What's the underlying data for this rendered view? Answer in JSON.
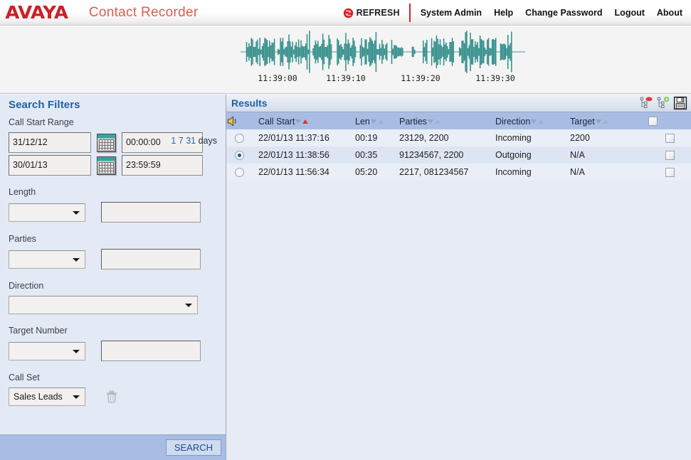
{
  "app": {
    "brand": "AVAYA",
    "title": "Contact Recorder"
  },
  "topnav": {
    "refresh_label": "REFRESH",
    "refresh_icon": "refresh-icon",
    "items": [
      {
        "label": "System Admin"
      },
      {
        "label": "Help"
      },
      {
        "label": "Change Password"
      },
      {
        "label": "Logout"
      },
      {
        "label": "About"
      }
    ]
  },
  "waveform": {
    "color": "#2f8c88",
    "time_labels": [
      "11:39:00",
      "11:39:10",
      "11:39:20",
      "11:39:30"
    ]
  },
  "filters": {
    "title": "Search Filters",
    "call_start_range": {
      "label": "Call Start Range",
      "day_links": [
        "1",
        "7",
        "31"
      ],
      "day_suffix": "days",
      "from_date": "31/12/12",
      "to_date": "30/01/13",
      "from_time": "00:00:00",
      "to_time": "23:59:59",
      "calendar_icon": "calendar-icon"
    },
    "length": {
      "label": "Length",
      "operator": "",
      "value": ""
    },
    "parties": {
      "label": "Parties",
      "operator": "",
      "value": ""
    },
    "direction": {
      "label": "Direction",
      "value": ""
    },
    "target_number": {
      "label": "Target Number",
      "operator": "",
      "value": ""
    },
    "call_set": {
      "label": "Call Set",
      "value": "Sales Leads",
      "delete_icon": "trash-icon"
    },
    "search_button": "SEARCH"
  },
  "results": {
    "title": "Results",
    "tools": [
      {
        "name": "remove-from-callset-icon"
      },
      {
        "name": "add-to-callset-icon"
      },
      {
        "name": "save-icon"
      }
    ],
    "columns": [
      {
        "key": "select",
        "label": "",
        "icon": "speaker-icon"
      },
      {
        "key": "call_start",
        "label": "Call Start",
        "sort": "asc"
      },
      {
        "key": "len",
        "label": "Len",
        "sort": "none"
      },
      {
        "key": "parties",
        "label": "Parties",
        "sort": "none"
      },
      {
        "key": "direction",
        "label": "Direction",
        "sort": "none"
      },
      {
        "key": "target",
        "label": "Target",
        "sort": "none"
      },
      {
        "key": "check",
        "label": ""
      }
    ],
    "rows": [
      {
        "selected": false,
        "call_start": "22/01/13 11:37:16",
        "len": "00:19",
        "parties": "23129, 2200",
        "direction": "Incoming",
        "target": "2200",
        "checked": false
      },
      {
        "selected": true,
        "call_start": "22/01/13 11:38:56",
        "len": "00:35",
        "parties": "91234567, 2200",
        "direction": "Outgoing",
        "target": "N/A",
        "checked": false
      },
      {
        "selected": false,
        "call_start": "22/01/13 11:56:34",
        "len": "05:20",
        "parties": "2217, 081234567",
        "direction": "Incoming",
        "target": "N/A",
        "checked": false
      }
    ]
  },
  "colors": {
    "brand_red": "#cc2027",
    "title_blue": "#1f5fa9",
    "panel_bg": "#e3eaf6",
    "header_row": "#a9bde4",
    "waveform": "#2f8c88"
  }
}
